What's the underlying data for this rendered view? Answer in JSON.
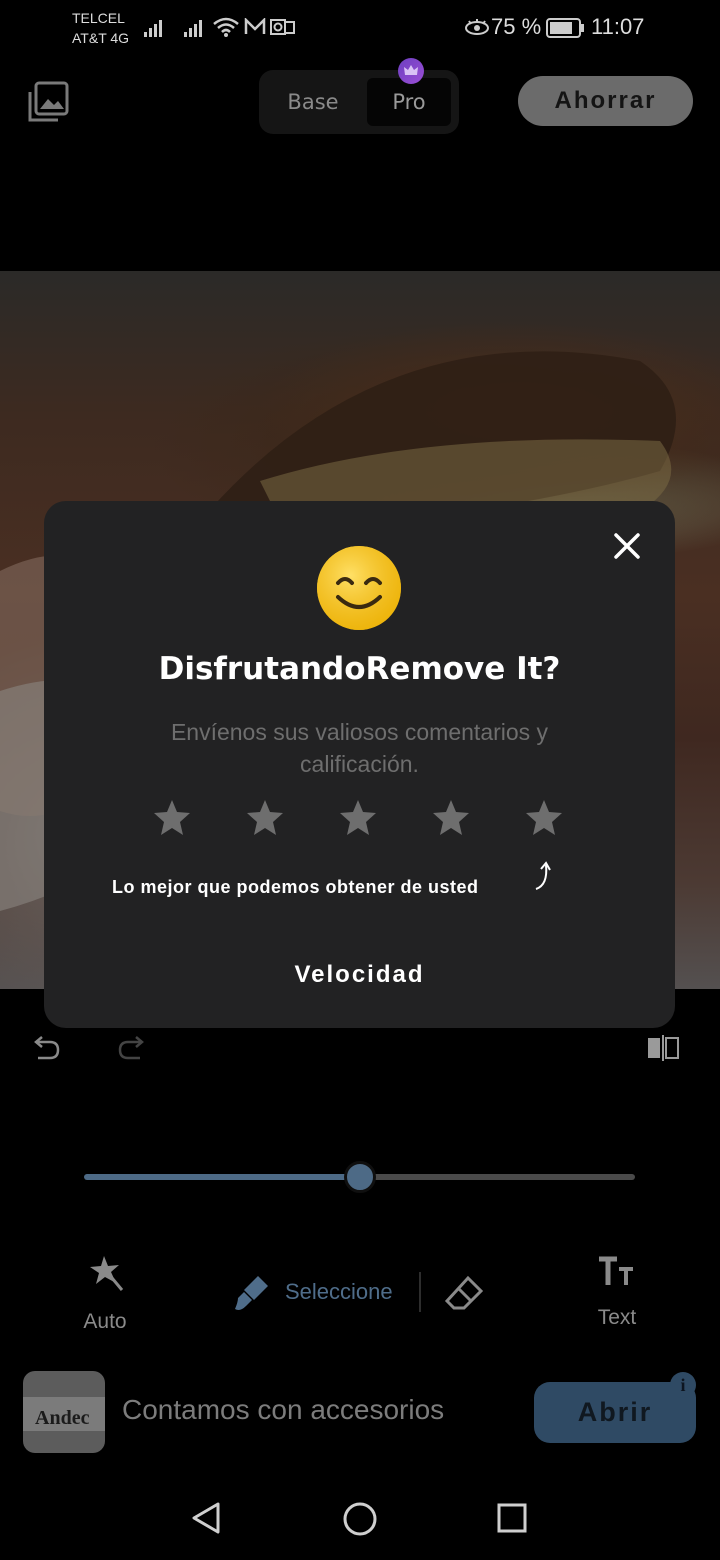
{
  "status_bar": {
    "carrier_1": "TELCEL",
    "carrier_2": "AT&T 4G",
    "battery": "75 %",
    "time": "11:07"
  },
  "toolbar": {
    "mode_base": "Base",
    "mode_pro": "Pro",
    "save_label": "Ahorrar"
  },
  "dialog": {
    "title": "DisfrutandoRemove It?",
    "subtitle": "Envíenos sus valiosos comentarios y calificación.",
    "rating_value": 0,
    "rating_max": 5,
    "hint": "Lo mejor que podemos obtener de usted",
    "rate_button": "Velocidad"
  },
  "brush_slider": {
    "value_fraction": 0.5
  },
  "tools": {
    "auto_label": "Auto",
    "select_label": "Seleccione",
    "text_label": "Text"
  },
  "ad": {
    "logo_text": "Andec",
    "headline": "Contamos con accesorios",
    "cta": "Abrir",
    "info": "i"
  },
  "colors": {
    "accent": "#4f6d8a",
    "dialog_bg": "#222223",
    "star": "#6e6e6e",
    "emoji": "#f5c518"
  }
}
